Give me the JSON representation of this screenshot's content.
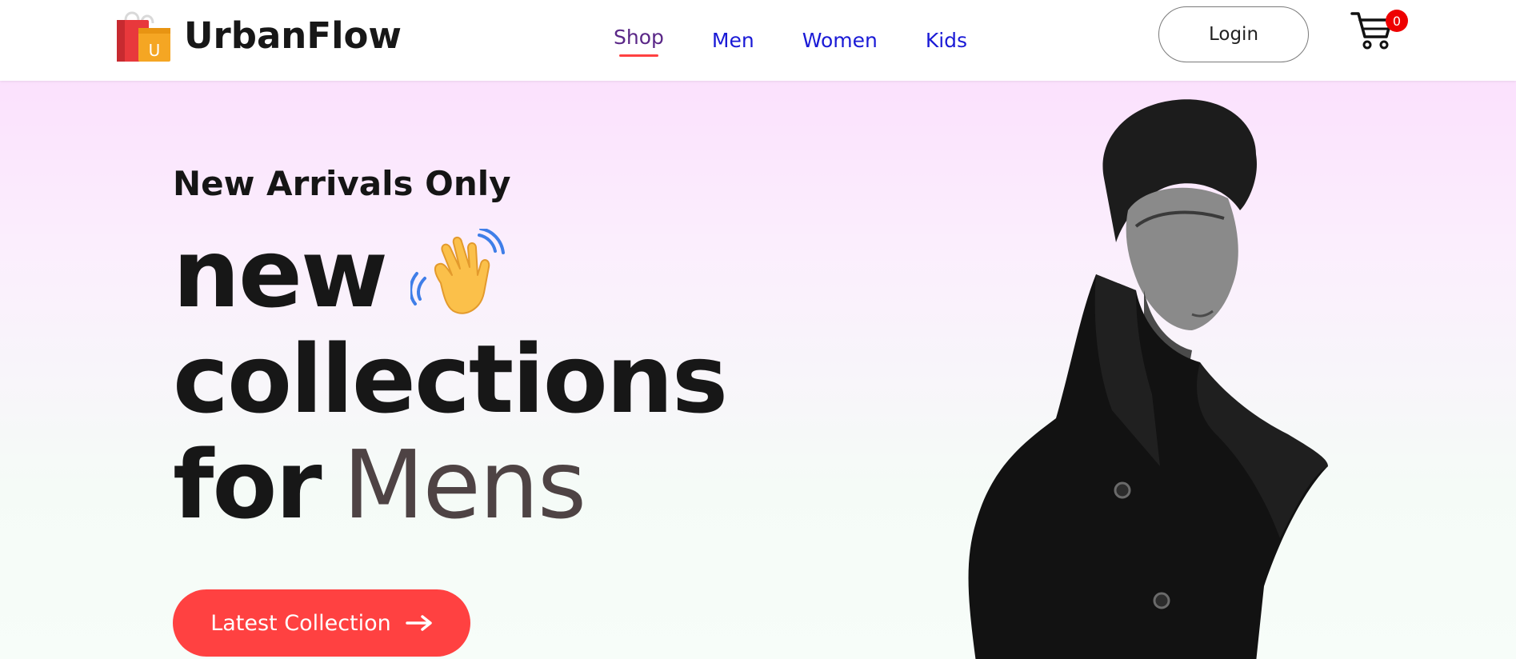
{
  "brand": {
    "name": "UrbanFlow",
    "logo_icon": "shopping-bag-icon",
    "logo_letter": "U"
  },
  "nav": {
    "items": [
      {
        "label": "Shop",
        "active": true
      },
      {
        "label": "Men",
        "active": false
      },
      {
        "label": "Women",
        "active": false
      },
      {
        "label": "Kids",
        "active": false
      }
    ]
  },
  "header": {
    "login_label": "Login",
    "cart_icon": "cart-icon",
    "cart_count": "0"
  },
  "hero": {
    "tagline": "New Arrivals Only",
    "headline_line1": "new",
    "wave_icon": "waving-hand-icon",
    "headline_line2": "collections",
    "headline_line3_a": "for",
    "headline_line3_b": "Mens",
    "cta_label": "Latest Collection",
    "cta_icon": "arrow-right-icon",
    "hero_image": "model-in-black-coat-photo"
  },
  "colors": {
    "accent": "#ff4141",
    "nav_link": "#1a1ad6",
    "nav_active": "#5a2787",
    "hero_gradient_top": "#fbe1fd",
    "hero_gradient_bottom": "#f7fdf9",
    "badge": "#ee0000"
  }
}
